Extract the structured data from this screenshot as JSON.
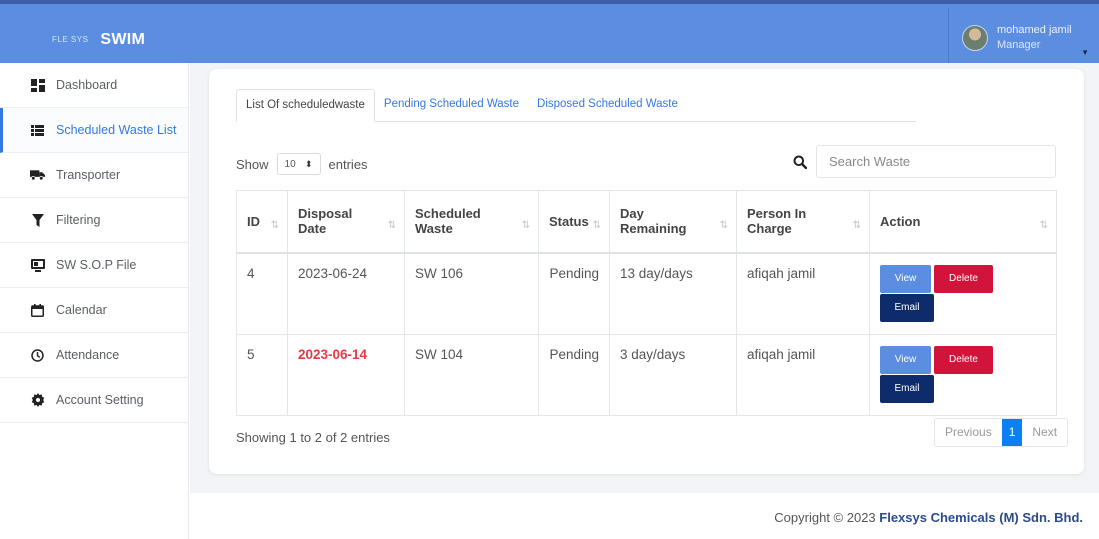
{
  "brand": {
    "small": "FLE SYS",
    "title": "SWIM"
  },
  "user": {
    "name": "mohamed jamil",
    "role": "Manager"
  },
  "sidebar": {
    "items": [
      {
        "label": "Dashboard",
        "icon": "dashboard-icon"
      },
      {
        "label": "Scheduled Waste List",
        "icon": "list-icon",
        "active": true
      },
      {
        "label": "Transporter",
        "icon": "truck-icon"
      },
      {
        "label": "Filtering",
        "icon": "filter-icon"
      },
      {
        "label": "SW S.O.P File",
        "icon": "file-icon"
      },
      {
        "label": "Calendar",
        "icon": "calendar-icon"
      },
      {
        "label": "Attendance",
        "icon": "clock-icon"
      },
      {
        "label": "Account Setting",
        "icon": "gear-icon"
      }
    ]
  },
  "tabs": [
    {
      "label": "List Of scheduledwaste",
      "active": true
    },
    {
      "label": "Pending Scheduled Waste"
    },
    {
      "label": "Disposed Scheduled Waste"
    }
  ],
  "controls": {
    "show_label": "Show",
    "page_size": "10",
    "entries_label": "entries",
    "search_placeholder": "Search Waste"
  },
  "table": {
    "headers": [
      "ID",
      "Disposal Date",
      "Scheduled Waste",
      "Status",
      "Day Remaining",
      "Person In Charge",
      "Action"
    ],
    "rows": [
      {
        "id": "4",
        "date": "2023-06-24",
        "waste": "SW 106",
        "status": "Pending",
        "remaining": "13 day/days",
        "person": "afiqah jamil"
      },
      {
        "id": "5",
        "date": "2023-06-14",
        "waste": "SW 104",
        "status": "Pending",
        "remaining": "3 day/days",
        "person": "afiqah jamil"
      }
    ],
    "actions": {
      "view": "View",
      "delete": "Delete",
      "email": "Email"
    }
  },
  "summary": "Showing 1 to 2 of 2 entries",
  "pagination": {
    "previous": "Previous",
    "current": "1",
    "next": "Next"
  },
  "footer": {
    "prefix": "Copyright © 2023 ",
    "company": "Flexsys Chemicals (M) Sdn. Bhd."
  },
  "colors": {
    "accent": "#3578e5",
    "topbar": "#5b8de0",
    "danger": "#d2143a",
    "email": "#0e2c6b",
    "overdue": "#e43a45"
  }
}
